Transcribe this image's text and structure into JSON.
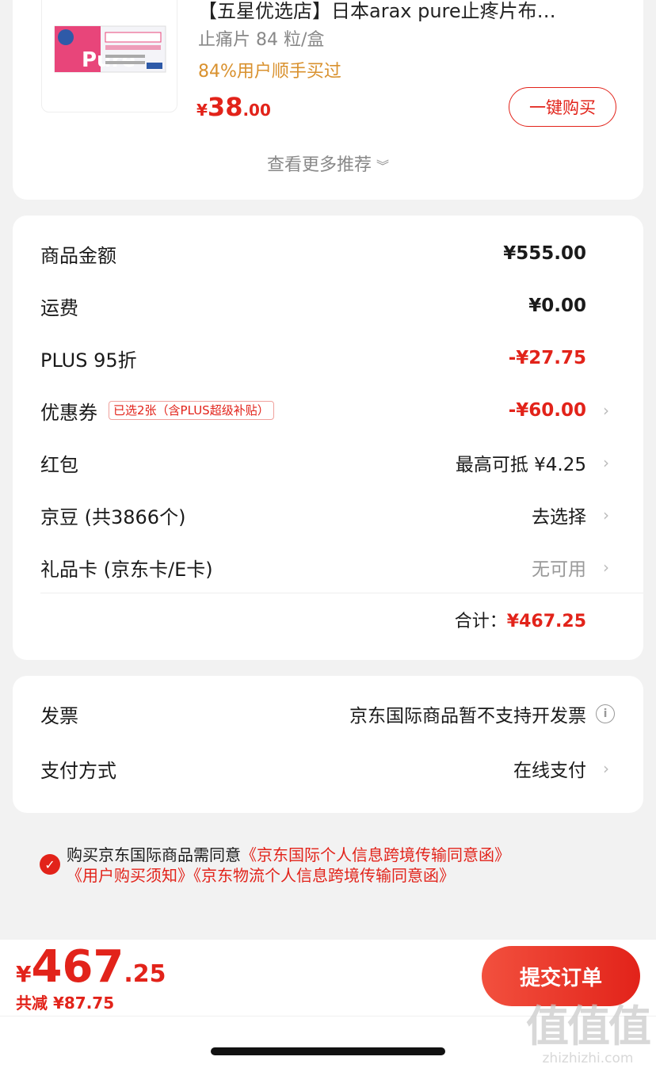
{
  "product": {
    "title": "【五星优选店】日本arax pure止疼片布…",
    "spec": "止痛片 84 粒/盒",
    "social_proof": "84%用户顺手买过",
    "price_symbol": "¥",
    "price_int": "38",
    "price_dec": ".00",
    "buy_button": "一键购买",
    "image_text": "Pure"
  },
  "more_recommendations": "查看更多推荐",
  "summary": {
    "rows": [
      {
        "label": "商品金额",
        "value": "¥555.00"
      },
      {
        "label": "运费",
        "value": "¥0.00"
      },
      {
        "label": "PLUS 95折",
        "value": "-¥27.75"
      },
      {
        "label": "优惠券",
        "tag": "已选2张（含PLUS超级补贴）",
        "value": "-¥60.00"
      },
      {
        "label": "红包",
        "value": "最高可抵 ¥4.25"
      },
      {
        "label": "京豆 (共3866个)",
        "value": "去选择"
      },
      {
        "label": "礼品卡 (京东卡/E卡)",
        "value": "无可用"
      }
    ],
    "total_label": "合计：",
    "total_value": "¥467.25"
  },
  "invoice": {
    "label": "发票",
    "value": "京东国际商品暂不支持开发票",
    "payment_label": "支付方式",
    "payment_value": "在线支付"
  },
  "agreement": {
    "prefix": "购买京东国际商品需同意",
    "link1": "《京东国际个人信息跨境传输同意函》",
    "link2": "《用户购买须知》",
    "link3": "《京东物流个人信息跨境传输同意函》"
  },
  "bottom": {
    "price_symbol": "¥",
    "price_int": "467",
    "price_dec": ".25",
    "discount_total": "共减 ¥87.75",
    "submit": "提交订单"
  },
  "watermark": {
    "big": "值值值",
    "small": "zhizhizhi.com"
  },
  "colors": {
    "accent": "#e2231a",
    "social": "#d9912e",
    "background": "#f2f2f2"
  }
}
